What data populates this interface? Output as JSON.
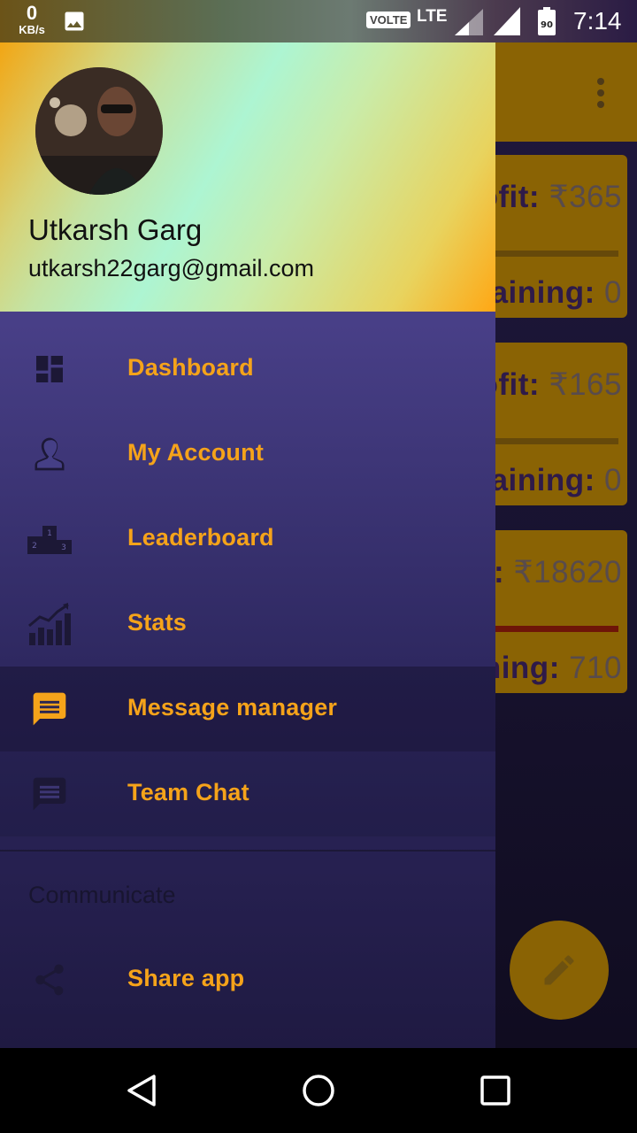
{
  "status_bar": {
    "net_speed_value": "0",
    "net_speed_unit": "KB/s",
    "volte": "VOLTE",
    "network": "LTE",
    "battery": "90",
    "time": "7:14"
  },
  "drawer": {
    "user_name": "Utkarsh Garg",
    "user_email": "utkarsh22garg@gmail.com",
    "items": [
      {
        "label": "Dashboard",
        "icon": "dashboard-icon"
      },
      {
        "label": "My Account",
        "icon": "account-icon"
      },
      {
        "label": "Leaderboard",
        "icon": "podium-icon"
      },
      {
        "label": "Stats",
        "icon": "stats-icon"
      },
      {
        "label": "Message manager",
        "icon": "message-icon",
        "selected": true
      },
      {
        "label": "Team Chat",
        "icon": "chat-icon"
      }
    ],
    "section_label": "Communicate",
    "section_items": [
      {
        "label": "Share app",
        "icon": "share-icon"
      }
    ]
  },
  "background_cards": [
    {
      "profit_label": "ofit:",
      "profit_value": "₹365",
      "remaining_label": "naining:",
      "remaining_value": "0"
    },
    {
      "profit_label": "ofit:",
      "profit_value": "₹165",
      "remaining_label": "naining:",
      "remaining_value": "0"
    },
    {
      "profit_label": "t:",
      "profit_value": "₹18620",
      "remaining_label": "ning:",
      "remaining_value": "710"
    }
  ],
  "colors": {
    "accent": "#f5a31a",
    "drawer_bg": "#453f86",
    "app_bar": "#8a6304"
  }
}
